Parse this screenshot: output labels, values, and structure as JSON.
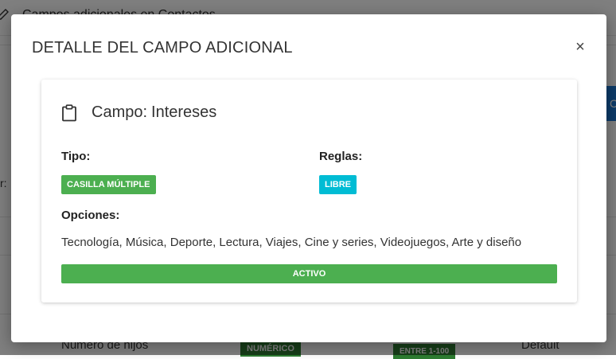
{
  "background": {
    "page_title": "Campos adicionales en Contactos",
    "side_label": "r:",
    "side_button_label": "CA",
    "row": {
      "name": "Número de hijos",
      "type_badge": "NUMÉRICO",
      "rule_badge": "ENTRE 1-100",
      "value": "Default"
    }
  },
  "modal": {
    "title": "DETALLE DEL CAMPO ADICIONAL",
    "close_label": "×",
    "field": {
      "title_prefix": "Campo:",
      "name": "Intereses",
      "icon": "clipboard-icon"
    },
    "type_label": "Tipo:",
    "type_value": "CASILLA MÚLTIPLE",
    "rules_label": "Reglas:",
    "rules_value": "LIBRE",
    "options_label": "Opciones:",
    "options_value": "Tecnología, Música, Deporte, Lectura, Viajes, Cine y series, Videojuegos, Arte y diseño",
    "status": "ACTIVO"
  },
  "colors": {
    "green": "#4caf50",
    "cyan": "#00bcd4",
    "blue": "#1976d2",
    "overlay": "rgba(0,0,0,0.5)"
  }
}
